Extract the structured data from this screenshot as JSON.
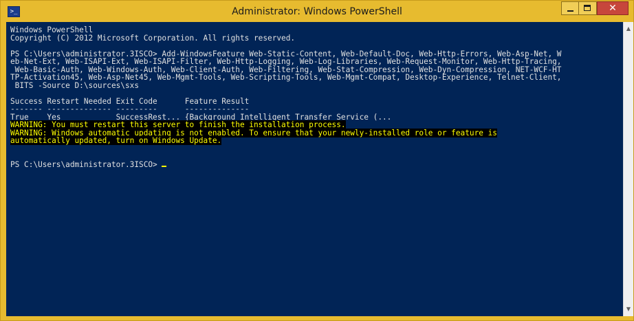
{
  "window": {
    "title": "Administrator: Windows PowerShell",
    "icon": "powershell-icon",
    "controls": {
      "minimize": "minimize-icon",
      "maximize": "maximize-icon",
      "close": "✕"
    }
  },
  "console": {
    "header": [
      "Windows PowerShell",
      "Copyright (C) 2012 Microsoft Corporation. All rights reserved."
    ],
    "command_lines": [
      "PS C:\\Users\\administrator.3ISCO> Add-WindowsFeature Web-Static-Content, Web-Default-Doc, Web-Http-Errors, Web-Asp-Net, W",
      "eb-Net-Ext, Web-ISAPI-Ext, Web-ISAPI-Filter, Web-Http-Logging, Web-Log-Libraries, Web-Request-Monitor, Web-Http-Tracing,",
      " Web-Basic-Auth, Web-Windows-Auth, Web-Client-Auth, Web-Filtering, Web-Stat-Compression, Web-Dyn-Compression, NET-WCF-HT",
      "TP-Activation45, Web-Asp-Net45, Web-Mgmt-Tools, Web-Scripting-Tools, Web-Mgmt-Compat, Desktop-Experience, Telnet-Client,",
      " BITS -Source D:\\sources\\sxs"
    ],
    "table": {
      "header": "Success Restart Needed Exit Code      Feature Result",
      "separator": "------- -------------- ---------      --------------",
      "row": "True    Yes            SuccessRest... {Background Intelligent Transfer Service (..."
    },
    "warnings": [
      "WARNING: You must restart this server to finish the installation process.",
      "WARNING: Windows automatic updating is not enabled. To ensure that your newly-installed role or feature is",
      "automatically updated, turn on Windows Update."
    ],
    "prompt": "PS C:\\Users\\administrator.3ISCO> ",
    "colors": {
      "background": "#012456",
      "text": "#e0e0e0",
      "warning_text": "#ffff00",
      "warning_bg": "#000000"
    }
  },
  "scrollbar": {
    "up": "scroll-up-icon",
    "down": "scroll-down-icon"
  }
}
